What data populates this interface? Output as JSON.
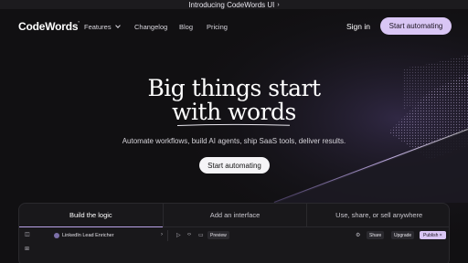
{
  "announcement": {
    "text": "Introducing CodeWords UI",
    "chevron": "›"
  },
  "nav": {
    "logo": "CodeWords",
    "logo_mark": "°",
    "items": [
      {
        "label": "Features",
        "has_dropdown": true
      },
      {
        "label": "Changelog"
      },
      {
        "label": "Blog"
      },
      {
        "label": "Pricing"
      }
    ],
    "sign_in": "Sign in",
    "cta": "Start automating"
  },
  "hero": {
    "title_line1": "Big things start",
    "title_line2": "with words",
    "subtitle": "Automate workflows, build AI agents, ship SaaS tools, deliver results.",
    "cta": "Start automating"
  },
  "panel": {
    "tabs": [
      {
        "label": "Build the logic",
        "active": true
      },
      {
        "label": "Add an interface",
        "active": false
      },
      {
        "label": "Use, share, or sell anywhere",
        "active": false
      }
    ],
    "toolbar": {
      "workflow_name": "LinkedIn Lead Enricher",
      "preview": "Preview",
      "share": "Share",
      "upgrade": "Upgrade",
      "publish": "Publish",
      "icons": [
        "sidebar-toggle-icon",
        "chevron-right-icon",
        "play-icon",
        "code-icon",
        "monitor-icon",
        "settings-icon",
        "close-icon"
      ]
    }
  },
  "colors": {
    "background": "#111012",
    "accent": "#d9c6f5",
    "beam": "#b9a3e8"
  }
}
